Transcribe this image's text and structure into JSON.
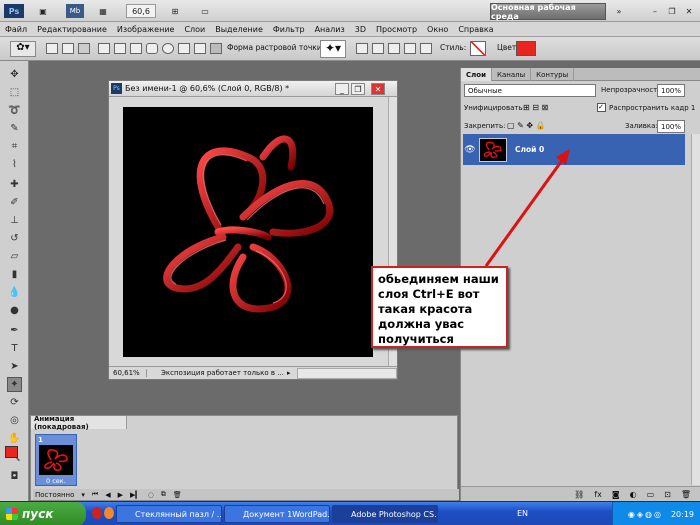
{
  "topbar": {
    "zoom_value": "60,6",
    "workspace_label": "Основная рабочая среда"
  },
  "menu": [
    "Файл",
    "Редактирование",
    "Изображение",
    "Слои",
    "Выделение",
    "Фильтр",
    "Анализ",
    "3D",
    "Просмотр",
    "Окно",
    "Справка"
  ],
  "options": {
    "brush_shape_label": "Форма растровой точки:",
    "style_label": "Стиль:",
    "color_label": "Цвет:",
    "color": "#e8261e"
  },
  "document": {
    "title": "Без имени-1 @ 60,6% (Слой 0, RGB/8) *",
    "zoom": "60,61%",
    "status": "Экспозиция работает только в ..."
  },
  "animation": {
    "tab": "Анимация (покадровая)",
    "frame_number": "1",
    "frame_time": "0 сек.",
    "loop": "Постоянно"
  },
  "layers_panel": {
    "tabs": [
      "Слои",
      "Каналы",
      "Контуры"
    ],
    "blend_mode": "Обычные",
    "opacity_label": "Непрозрачность:",
    "opacity_value": "100%",
    "unify_label": "Унифицировать:",
    "propagate_label": "Распространить кадр 1",
    "lock_label": "Закрепить:",
    "fill_label": "Заливка:",
    "fill_value": "100%",
    "layer_name": "Слой 0"
  },
  "annotation": {
    "text": "обьединяем наши\nслоя Ctrl+E  вот\nтакая красота\nдолжна увас\nполучиться",
    "border_color": "#cc2222"
  },
  "taskbar": {
    "start_label": "пуск",
    "tasks": [
      "Стеклянный пазл / ...",
      "Документ 1WordPad...",
      "Adobe Photoshop CS..."
    ],
    "lang": "EN",
    "time": "20:19"
  }
}
